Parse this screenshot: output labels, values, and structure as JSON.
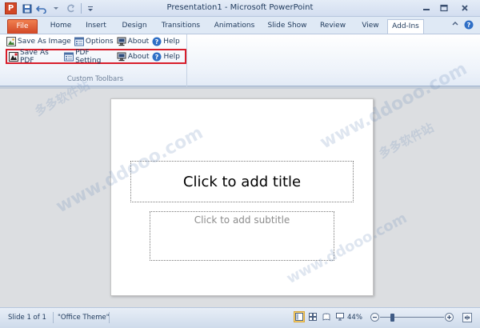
{
  "window": {
    "title": "Presentation1 - Microsoft PowerPoint",
    "app_icon_letter": "P"
  },
  "tabs": [
    {
      "label": "File"
    },
    {
      "label": "Home"
    },
    {
      "label": "Insert"
    },
    {
      "label": "Design"
    },
    {
      "label": "Transitions"
    },
    {
      "label": "Animations"
    },
    {
      "label": "Slide Show"
    },
    {
      "label": "Review"
    },
    {
      "label": "View"
    },
    {
      "label": "Add-Ins"
    }
  ],
  "ribbon": {
    "group_label": "Custom Toolbars",
    "row1": {
      "save_as_image": "Save As Image",
      "options": "Options",
      "about": "About",
      "help": "Help"
    },
    "row2": {
      "save_as_pdf": "Save As PDF",
      "pdf_setting": "PDF Setting",
      "about": "About",
      "help": "Help"
    }
  },
  "slide": {
    "title_placeholder": "Click to add title",
    "subtitle_placeholder": "Click to add subtitle"
  },
  "statusbar": {
    "slide_info": "Slide 1 of 1",
    "theme": "\"Office Theme\"",
    "zoom": "44%",
    "zoom_level_percent": 44
  },
  "watermark": {
    "text": "www.ddooo.com",
    "cn_text": "多多软件站"
  },
  "colors": {
    "file_tab": "#d24726",
    "highlight_border": "#d81e2b",
    "accent_text": "#1e395b"
  }
}
